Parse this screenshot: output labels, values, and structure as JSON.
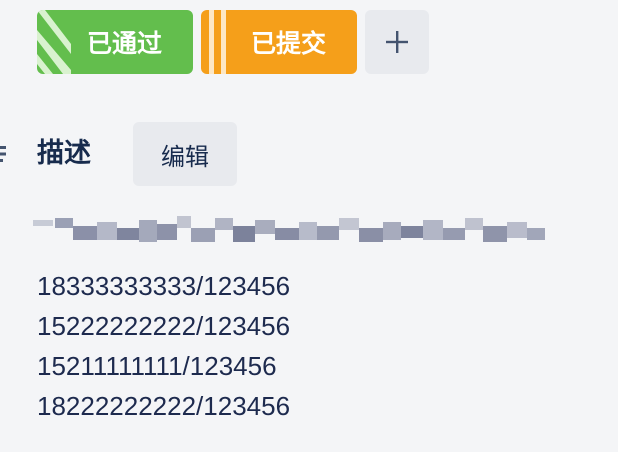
{
  "labels": [
    {
      "text": "已通过",
      "color": "#63be4d"
    },
    {
      "text": "已提交",
      "color": "#f59f1a"
    }
  ],
  "add_label": {
    "icon": "plus-icon"
  },
  "description": {
    "icon": "list-icon",
    "title": "描述",
    "edit_label": "编辑",
    "lines": [
      "18333333333/123456",
      "15222222222/123456",
      "15211111111/123456",
      "18222222222/123456"
    ]
  }
}
